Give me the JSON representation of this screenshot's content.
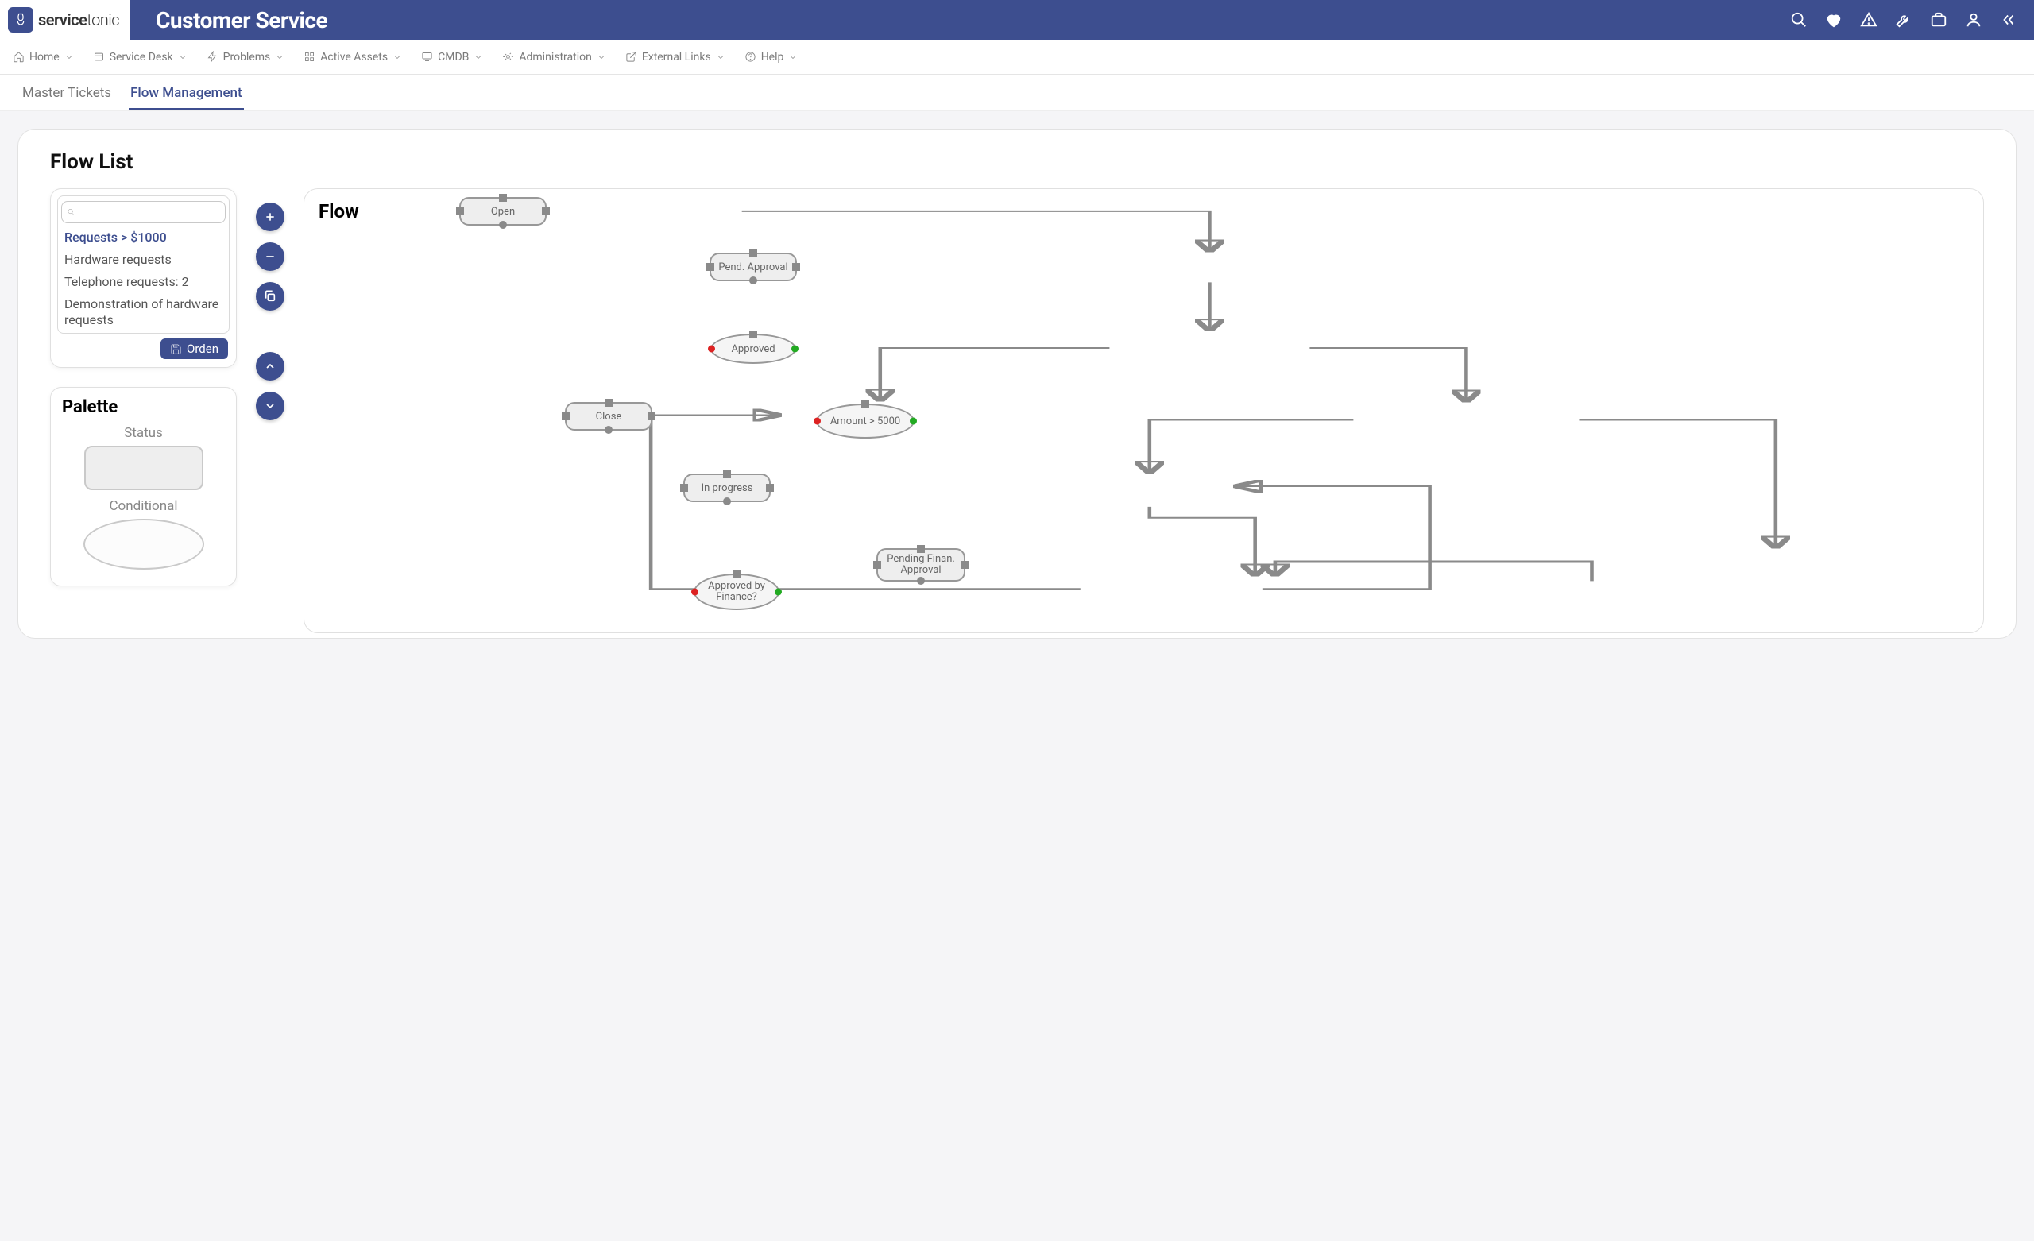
{
  "brand": {
    "name_bold": "service",
    "name_light": "tonic"
  },
  "header": {
    "title": "Customer Service"
  },
  "nav": {
    "items": [
      {
        "label": "Home"
      },
      {
        "label": "Service Desk"
      },
      {
        "label": "Problems"
      },
      {
        "label": "Active Assets"
      },
      {
        "label": "CMDB"
      },
      {
        "label": "Administration"
      },
      {
        "label": "External Links"
      },
      {
        "label": "Help"
      }
    ]
  },
  "tabs": {
    "items": [
      {
        "label": "Master Tickets",
        "active": false
      },
      {
        "label": "Flow Management",
        "active": true
      }
    ]
  },
  "flowList": {
    "title": "Flow List",
    "items": [
      "Requests > $1000",
      "Hardware requests",
      "Telephone requests: 2",
      "Demonstration of hardware requests"
    ],
    "selected_index": 0,
    "order_button": "Orden"
  },
  "palette": {
    "title": "Palette",
    "status_label": "Status",
    "conditional_label": "Conditional"
  },
  "flow": {
    "title": "Flow",
    "nodes": {
      "open": "Open",
      "pend_approval": "Pend. Approval",
      "approved": "Approved",
      "close": "Close",
      "amount": "Amount > 5000",
      "in_progress": "In progress",
      "pending_finan": "Pending Finan. Approval",
      "approved_finance": "Approved by Finance?"
    }
  }
}
